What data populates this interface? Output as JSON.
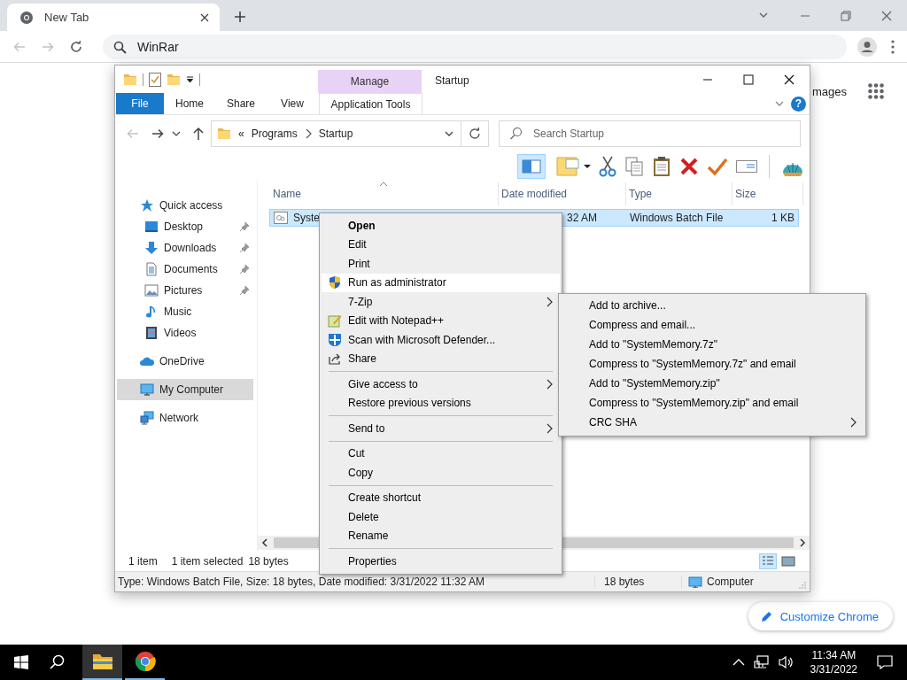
{
  "browser": {
    "tab_title": "New Tab",
    "address": "WinRar",
    "images_link": "mages",
    "customize_button": "Customize Chrome"
  },
  "explorer": {
    "context_tab": "Manage",
    "title": "Startup",
    "help_button": "?",
    "ribbon_tabs": [
      {
        "label": "File",
        "kind": "file"
      },
      {
        "label": "Home",
        "kind": "plain"
      },
      {
        "label": "Share",
        "kind": "plain"
      },
      {
        "label": "View",
        "kind": "plain"
      },
      {
        "label": "Application Tools",
        "kind": "context"
      }
    ],
    "path_overflow": "«",
    "breadcrumb": [
      "Programs",
      "Startup"
    ],
    "search": {
      "placeholder": "Search Startup"
    },
    "nav": [
      {
        "label": "Quick access",
        "kind": "star",
        "selected": false,
        "children": [
          {
            "label": "Desktop",
            "kind": "desktop",
            "pinned": true,
            "selected": false
          },
          {
            "label": "Downloads",
            "kind": "download",
            "pinned": true,
            "selected": false
          },
          {
            "label": "Documents",
            "kind": "document",
            "pinned": true,
            "selected": false
          },
          {
            "label": "Pictures",
            "kind": "picture",
            "pinned": true,
            "selected": false
          },
          {
            "label": "Music",
            "kind": "music",
            "pinned": false,
            "selected": false
          },
          {
            "label": "Videos",
            "kind": "video",
            "pinned": false,
            "selected": false
          }
        ]
      },
      {
        "label": "OneDrive",
        "kind": "cloud",
        "selected": false
      },
      {
        "label": "My Computer",
        "kind": "computer",
        "selected": true
      },
      {
        "label": "Network",
        "kind": "network",
        "selected": false
      }
    ],
    "columns": [
      "Name",
      "Date modified",
      "Type",
      "Size"
    ],
    "rows": [
      {
        "name": "Syste",
        "date": "32 AM",
        "type": "Windows Batch File",
        "size": "1 KB",
        "selected": true
      }
    ],
    "status": {
      "count": "1 item",
      "selection": "1 item selected",
      "selection_size": "18 bytes"
    },
    "views": [
      {
        "kind": "details",
        "selected": true
      },
      {
        "kind": "tiles",
        "selected": false
      }
    ],
    "details_bar": {
      "text": "Type: Windows Batch File, Size: 18 bytes, Date modified: 3/31/2022 11:32 AM",
      "size": "18 bytes",
      "location": "Computer"
    }
  },
  "context_menu": {
    "items": [
      {
        "label": "Open",
        "kind": "plain",
        "default": true,
        "highlighted": false,
        "submenu": false
      },
      {
        "label": "Edit",
        "kind": "plain",
        "default": false,
        "highlighted": false,
        "submenu": false
      },
      {
        "label": "Print",
        "kind": "plain",
        "default": false,
        "highlighted": false,
        "submenu": false
      },
      {
        "label": "Run as administrator",
        "kind": "shield",
        "default": false,
        "highlighted": true,
        "submenu": false
      },
      {
        "label": "7-Zip",
        "kind": "plain",
        "default": false,
        "highlighted": false,
        "submenu": true
      },
      {
        "label": "Edit with Notepad++",
        "kind": "notepad",
        "default": false,
        "highlighted": false,
        "submenu": false
      },
      {
        "label": "Scan with Microsoft Defender...",
        "kind": "defender",
        "default": false,
        "highlighted": false,
        "submenu": false
      },
      {
        "label": "Share",
        "kind": "share",
        "default": false,
        "highlighted": false,
        "submenu": false
      },
      {
        "kind": "separator"
      },
      {
        "label": "Give access to",
        "kind": "plain",
        "default": false,
        "highlighted": false,
        "submenu": true
      },
      {
        "label": "Restore previous versions",
        "kind": "plain",
        "default": false,
        "highlighted": false,
        "submenu": false
      },
      {
        "kind": "separator"
      },
      {
        "label": "Send to",
        "kind": "plain",
        "default": false,
        "highlighted": false,
        "submenu": true
      },
      {
        "kind": "separator"
      },
      {
        "label": "Cut",
        "kind": "plain",
        "default": false,
        "highlighted": false,
        "submenu": false
      },
      {
        "label": "Copy",
        "kind": "plain",
        "default": false,
        "highlighted": false,
        "submenu": false
      },
      {
        "kind": "separator"
      },
      {
        "label": "Create shortcut",
        "kind": "plain",
        "default": false,
        "highlighted": false,
        "submenu": false
      },
      {
        "label": "Delete",
        "kind": "plain",
        "default": false,
        "highlighted": false,
        "submenu": false
      },
      {
        "label": "Rename",
        "kind": "plain",
        "default": false,
        "highlighted": false,
        "submenu": false
      },
      {
        "kind": "separator"
      },
      {
        "label": "Properties",
        "kind": "plain",
        "default": false,
        "highlighted": false,
        "submenu": false
      }
    ]
  },
  "submenu": {
    "items": [
      {
        "label": "Add to archive...",
        "submenu": false
      },
      {
        "label": "Compress and email...",
        "submenu": false
      },
      {
        "label": "Add to \"SystemMemory.7z\"",
        "submenu": false
      },
      {
        "label": "Compress to \"SystemMemory.7z\" and email",
        "submenu": false
      },
      {
        "label": "Add to \"SystemMemory.zip\"",
        "submenu": false
      },
      {
        "label": "Compress to \"SystemMemory.zip\" and email",
        "submenu": false
      },
      {
        "label": "CRC SHA",
        "submenu": true
      }
    ]
  },
  "taskbar": {
    "apps": [
      {
        "kind": "explorer",
        "selected": true
      },
      {
        "kind": "chrome",
        "selected": false
      }
    ],
    "time": "11:34 AM",
    "date": "3/31/2022"
  }
}
